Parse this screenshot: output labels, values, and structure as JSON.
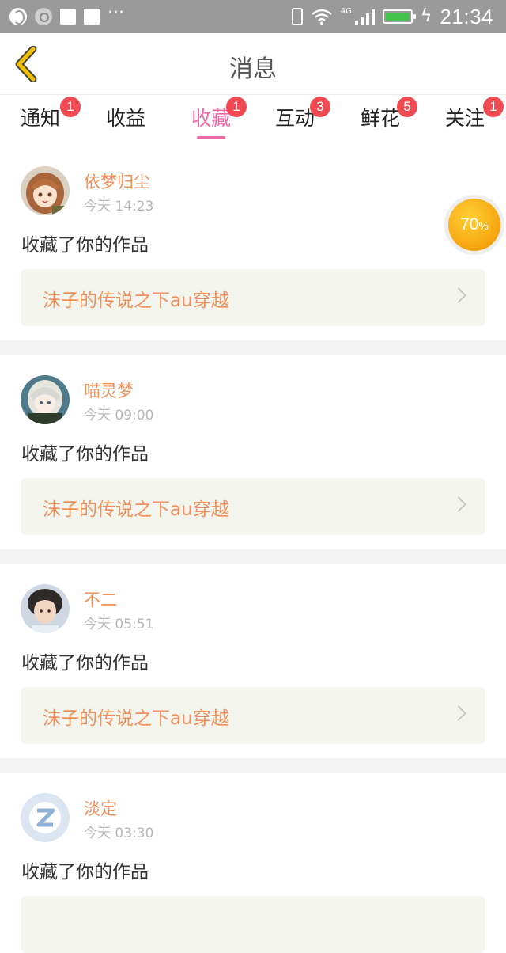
{
  "status_bar": {
    "time": "21:34",
    "network": "4G",
    "dots": "···",
    "colors": {
      "bar": "#9a9a9a",
      "battery": "#43c34c"
    }
  },
  "header": {
    "title": "消息"
  },
  "tabs": [
    {
      "label": "通知",
      "badge": "1",
      "active": false
    },
    {
      "label": "收益",
      "badge": "",
      "active": false
    },
    {
      "label": "收藏",
      "badge": "1",
      "active": true
    },
    {
      "label": "互动",
      "badge": "3",
      "active": false
    },
    {
      "label": "鲜花",
      "badge": "5",
      "active": false
    },
    {
      "label": "关注",
      "badge": "1",
      "active": false
    }
  ],
  "messages": [
    {
      "user": "依梦归尘",
      "time": "今天 14:23",
      "action": "收藏了你的作品",
      "work": "沫子的传说之下au穿越",
      "avatar": "anime-girl-avatar"
    },
    {
      "user": "喵灵梦",
      "time": "今天 09:00",
      "action": "收藏了你的作品",
      "work": "沫子的传说之下au穿越",
      "avatar": "anime-boy-avatar"
    },
    {
      "user": "不二",
      "time": "今天 05:51",
      "action": "收藏了你的作品",
      "work": "沫子的传说之下au穿越",
      "avatar": "photo-avatar"
    },
    {
      "user": "淡定",
      "time": "今天 03:30",
      "action": "收藏了你的作品",
      "work": "",
      "avatar": "default-qq-avatar"
    }
  ],
  "progress_ball": {
    "value": "70",
    "unit": "%"
  },
  "colors": {
    "accent_pink": "#e96aa6",
    "badge_red": "#f04a52",
    "username_orange": "#f0905a",
    "back_arrow": "#f2c200"
  }
}
